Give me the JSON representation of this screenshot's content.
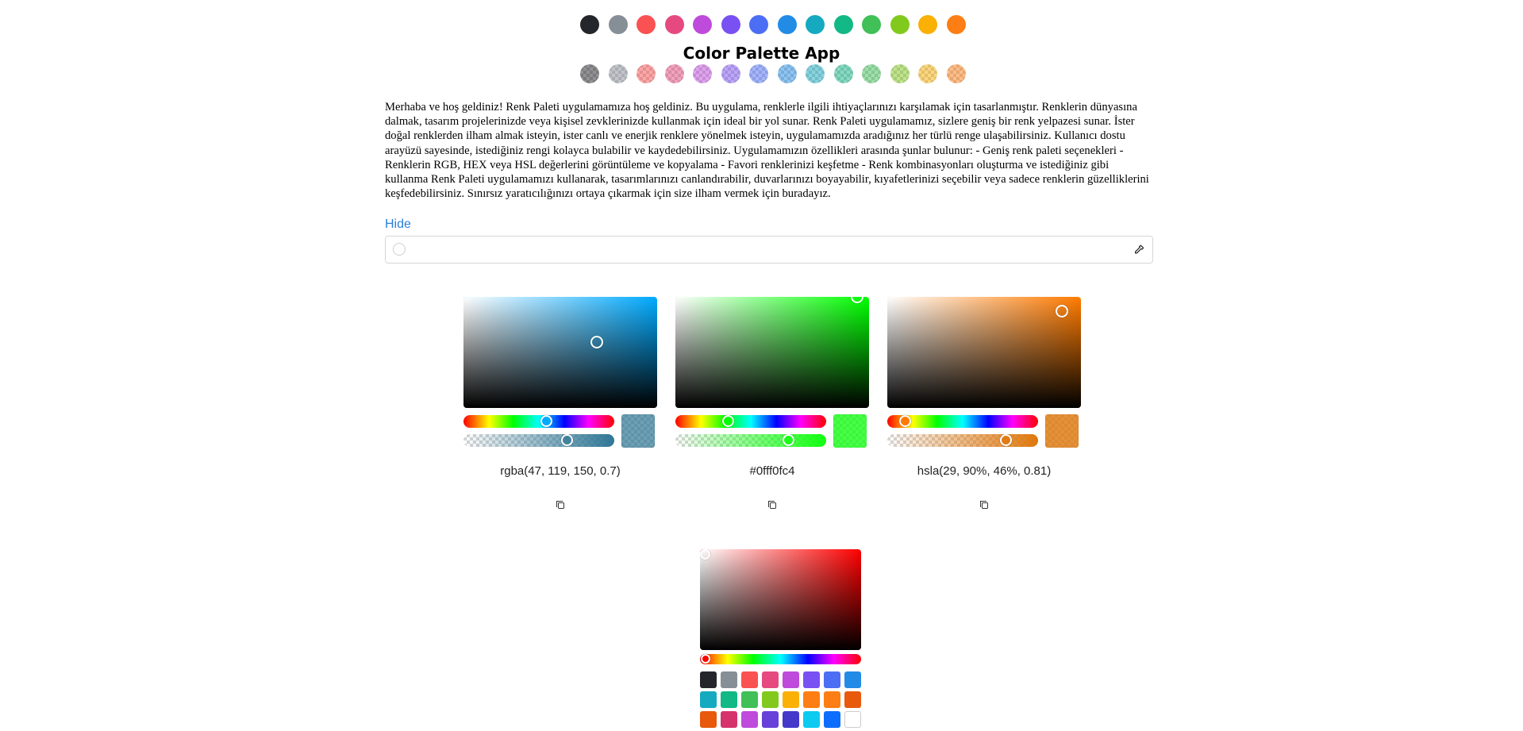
{
  "app": {
    "title": "Color Palette App"
  },
  "palette": {
    "solid": [
      {
        "name": "dark",
        "hex": "#25262b"
      },
      {
        "name": "gray",
        "hex": "#868e96"
      },
      {
        "name": "red",
        "hex": "#fa5252"
      },
      {
        "name": "pink",
        "hex": "#e64980"
      },
      {
        "name": "grape",
        "hex": "#be4bdb"
      },
      {
        "name": "violet",
        "hex": "#7950f2"
      },
      {
        "name": "indigo",
        "hex": "#4c6ef5"
      },
      {
        "name": "blue",
        "hex": "#228be6"
      },
      {
        "name": "cyan",
        "hex": "#15aabf"
      },
      {
        "name": "teal",
        "hex": "#12b886"
      },
      {
        "name": "green",
        "hex": "#40c057"
      },
      {
        "name": "lime",
        "hex": "#82c91e"
      },
      {
        "name": "yellow",
        "hex": "#fab005"
      },
      {
        "name": "orange",
        "hex": "#fd7e14"
      }
    ],
    "alpha": 0.5
  },
  "intro": {
    "text": "Merhaba ve hoş geldiniz! Renk Paleti uygulamamıza hoş geldiniz. Bu uygulama, renklerle ilgili ihtiyaçlarınızı karşılamak için tasarlanmıştır. Renklerin dünyasına dalmak, tasarım projelerinizde veya kişisel zevklerinizde kullanmak için ideal bir yol sunar. Renk Paleti uygulamamız, sizlere geniş bir renk yelpazesi sunar. İster doğal renklerden ilham almak isteyin, ister canlı ve enerjik renklere yönelmek isteyin, uygulamamızda aradığınız her türlü renge ulaşabilirsiniz. Kullanıcı dostu arayüzü sayesinde, istediğiniz rengi kolayca bulabilir ve kaydedebilirsiniz. Uygulamamızın özellikleri arasında şunlar bulunur: - Geniş renk paleti seçenekleri - Renklerin RGB, HEX veya HSL değerlerini görüntüleme ve kopyalama - Favori renklerinizi keşfetme - Renk kombinasyonları oluşturma ve istediğiniz gibi kullanma Renk Paleti uygulamamızı kullanarak, tasarımlarınızı canlandırabilir, duvarlarınızı boyayabilir, kıyafetlerinizi seçebilir veya sadece renklerin güzelliklerini keşfedebilirsiniz. Sınırsız yaratıcılığınızı ortaya çıkarmak için size ilham vermek için buradayız.",
    "toggle_label": "Hide"
  },
  "color_input": {
    "value": "",
    "placeholder": "",
    "icon": "eyedropper-icon"
  },
  "pickers": [
    {
      "format": "rgba",
      "value": "rgba(47, 119, 150, 0.7)",
      "hue_hex": "#00aaff",
      "hue_deg": 198,
      "saturation": 0.69,
      "brightness": 0.59,
      "alpha": 0.7,
      "color": "rgba(47,119,150,0.7)",
      "solid": "rgb(47,119,150)"
    },
    {
      "format": "hex",
      "value": "#0fff0fc4",
      "hue_hex": "#00ff00",
      "hue_deg": 120,
      "saturation": 0.94,
      "brightness": 1.0,
      "alpha": 0.77,
      "color": "rgba(15,255,15,0.77)",
      "solid": "rgb(15,255,15)"
    },
    {
      "format": "hsla",
      "value": "hsla(29, 90%, 46%, 0.81)",
      "hue_hex": "#ff7b00",
      "hue_deg": 29,
      "saturation": 0.9,
      "brightness": 0.87,
      "alpha": 0.81,
      "color": "rgba(223,119,12,0.81)",
      "solid": "rgb(223,119,12)"
    }
  ],
  "swatch_picker": {
    "hue_hex": "#ff0000",
    "hue_deg": 0,
    "saturation": 0.0,
    "brightness": 1.0,
    "swatches": [
      "#25262b",
      "#868e96",
      "#fa5252",
      "#e64980",
      "#be4bdb",
      "#7950f2",
      "#4c6ef5",
      "#228be6",
      "#15aabf",
      "#12b886",
      "#40c057",
      "#82c91e",
      "#fab005",
      "#fd7e14",
      "#fd7e14",
      "#e8590c",
      "#e8590c",
      "#d6336c",
      "#be4bdb",
      "#6741d9",
      "#4338ca",
      "#0dcaf0",
      "#0d6efd",
      "#ffffff"
    ]
  }
}
